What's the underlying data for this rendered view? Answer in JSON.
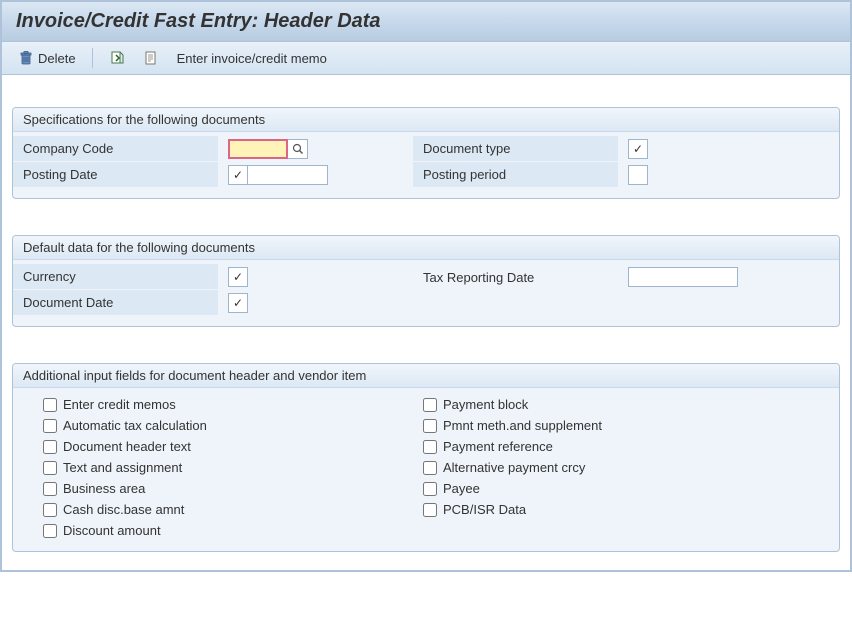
{
  "title": "Invoice/Credit Fast Entry: Header Data",
  "toolbar": {
    "delete_label": "Delete",
    "enter_memo_label": "Enter invoice/credit memo"
  },
  "groups": {
    "specs": {
      "title": "Specifications for the following documents",
      "fields": {
        "company_code": {
          "label": "Company Code",
          "value": ""
        },
        "document_type": {
          "label": "Document type"
        },
        "posting_date": {
          "label": "Posting Date"
        },
        "posting_period": {
          "label": "Posting period",
          "value": ""
        }
      }
    },
    "defaults": {
      "title": "Default data for the following documents",
      "fields": {
        "currency": {
          "label": "Currency"
        },
        "tax_reporting_date": {
          "label": "Tax Reporting Date",
          "value": ""
        },
        "document_date": {
          "label": "Document Date"
        }
      }
    },
    "additional": {
      "title": "Additional input fields for document header and vendor item",
      "checkboxes": {
        "left": [
          "Enter credit memos",
          "Automatic tax calculation",
          "Document header text",
          "Text and assignment",
          "Business area",
          "Cash disc.base amnt",
          "Discount amount"
        ],
        "right": [
          "Payment block",
          "Pmnt meth.and supplement",
          "Payment reference",
          "Alternative payment crcy",
          "Payee",
          "PCB/ISR Data"
        ]
      }
    }
  }
}
